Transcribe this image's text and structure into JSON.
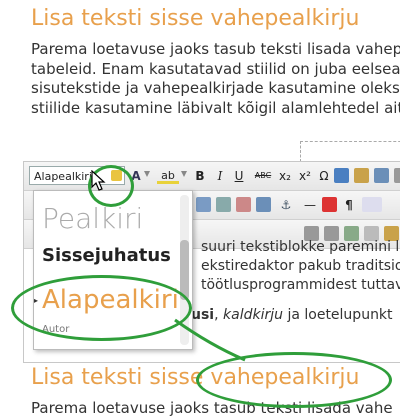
{
  "page": {
    "heading_top": "Lisa teksti sisse vahepealkirju",
    "paragraph_lines": [
      "Parema loetavuse jaoks tasub teksti lisada vahep",
      "tabeleid. Enam kasutatavad stiilid on juba eelsead",
      "sisutekstide ja vahepealkirjade kasutamine oleks",
      "stiilide kasutamine läbivalt kõigil alamlehtedel aita"
    ],
    "heading_bottom": "Lisa teksti sisse vahepealkirju",
    "bottom_paragraph": "Parema loetavuse jaoks tasub teksti lisada vahe"
  },
  "editor": {
    "format_select_value": "Alapealkiri",
    "toolbar_buttons": [
      "B",
      "I",
      "U",
      "ABC",
      "x₂",
      "x²",
      "Ω"
    ],
    "body_text_lines": [
      "suuri tekstiblokke paremini l",
      "ekstiredaktor pakub traditsio",
      "töötlusprogrammidest tuttav"
    ],
    "body_line4_bold": "usi",
    "body_line4_rest_italic": "kaldkirju",
    "body_line4_tail": " ja loetelupunkt"
  },
  "dropdown": {
    "items": [
      "Pealkiri",
      "Sissejuhatus",
      "Alapealkiri",
      "Autor"
    ],
    "selected_index": 2
  },
  "colors": {
    "heading": "#e8a04c",
    "highlight_ring": "#2f9e3a"
  }
}
